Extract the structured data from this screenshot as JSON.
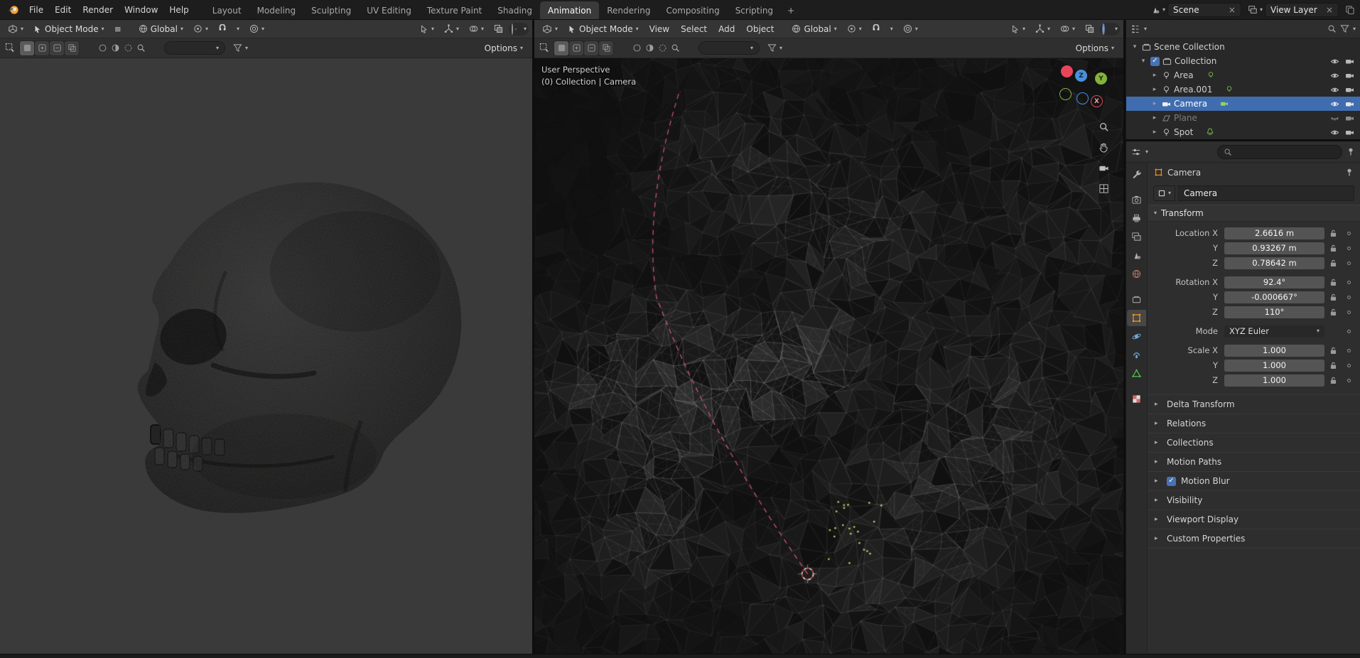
{
  "topbar": {
    "menus": [
      "File",
      "Edit",
      "Render",
      "Window",
      "Help"
    ],
    "workspaces": [
      "Layout",
      "Modeling",
      "Sculpting",
      "UV Editing",
      "Texture Paint",
      "Shading",
      "Animation",
      "Rendering",
      "Compositing",
      "Scripting"
    ],
    "active_workspace": "Animation",
    "add_workspace_label": "+",
    "scene_name": "Scene",
    "view_layer_name": "View Layer"
  },
  "viewport_left": {
    "mode": "Object Mode",
    "orientation": "Global",
    "options_label": "Options"
  },
  "viewport_right": {
    "mode": "Object Mode",
    "menus": [
      "View",
      "Select",
      "Add",
      "Object"
    ],
    "orientation": "Global",
    "options_label": "Options",
    "overlay_line1": "User Perspective",
    "overlay_line2": "(0) Collection | Camera",
    "gizmo": {
      "x": "X",
      "y": "Y",
      "z": "Z"
    }
  },
  "outliner": {
    "root": "Scene Collection",
    "collection": "Collection",
    "items": [
      {
        "label": "Area"
      },
      {
        "label": "Area.001"
      },
      {
        "label": "Camera"
      },
      {
        "label": "Plane"
      },
      {
        "label": "Spot"
      }
    ]
  },
  "properties": {
    "tabs": [
      "Tool",
      "Render",
      "Output",
      "View Layer",
      "Scene",
      "World",
      "Collection",
      "Object",
      "Physics",
      "Constraints",
      "Object Data",
      "Texture"
    ],
    "active_tab": "Object",
    "breadcrumb_object": "Camera",
    "object_name": "Camera",
    "transform_title": "Transform",
    "transform_rows": [
      {
        "label": "Location X",
        "value": "2.6616 m"
      },
      {
        "label": "Y",
        "value": "0.93267 m"
      },
      {
        "label": "Z",
        "value": "0.78642 m"
      },
      {
        "label": "Rotation X",
        "value": "92.4°"
      },
      {
        "label": "Y",
        "value": "-0.000667°"
      },
      {
        "label": "Z",
        "value": "110°"
      },
      {
        "label": "Mode",
        "value": "XYZ Euler"
      },
      {
        "label": "Scale X",
        "value": "1.000"
      },
      {
        "label": "Y",
        "value": "1.000"
      },
      {
        "label": "Z",
        "value": "1.000"
      }
    ],
    "sections": [
      "Delta Transform",
      "Relations",
      "Collections",
      "Motion Paths",
      "Motion Blur",
      "Visibility",
      "Viewport Display",
      "Custom Properties"
    ],
    "motion_blur_checked": true
  },
  "colors": {
    "accent_blue": "#4772b3",
    "object_orange": "#e8870e",
    "axis_x": "#e8455b",
    "axis_y": "#84b33c",
    "axis_z": "#4a90d9",
    "selected_row": "#3f6daf"
  }
}
